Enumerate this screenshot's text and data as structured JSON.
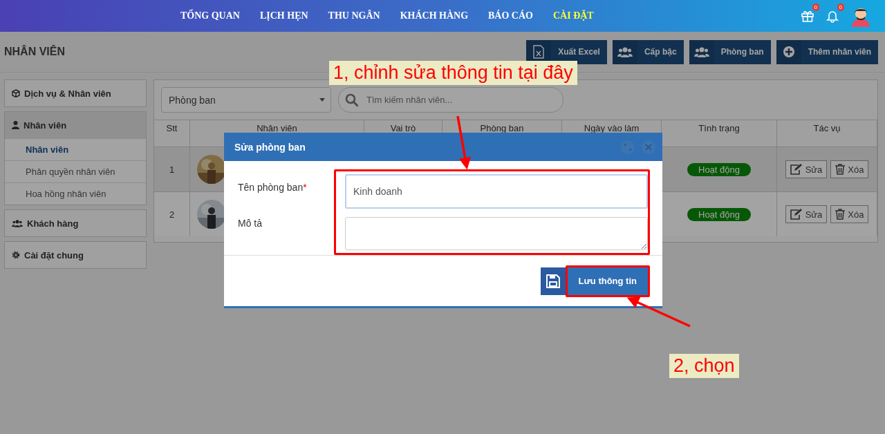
{
  "nav": {
    "items": [
      {
        "label": "TỔNG QUAN",
        "selected": false
      },
      {
        "label": "LỊCH HẸN",
        "selected": false
      },
      {
        "label": "THU NGÂN",
        "selected": false
      },
      {
        "label": "KHÁCH HÀNG",
        "selected": false
      },
      {
        "label": "BÁO CÁO",
        "selected": false
      },
      {
        "label": "CÀI ĐẶT",
        "selected": true
      }
    ],
    "gift_badge": "0",
    "bell_badge": "0"
  },
  "page_title": "NHÂN VIÊN",
  "actions": [
    {
      "label": "Xuất Excel",
      "kind": "excel"
    },
    {
      "label": "Cấp bậc",
      "kind": "group"
    },
    {
      "label": "Phòng ban",
      "kind": "group"
    },
    {
      "label": "Thêm nhân viên",
      "kind": "plus"
    }
  ],
  "sidebar": [
    {
      "label": "Dịch vụ & Nhân viên",
      "kind": "box"
    },
    {
      "label": "Nhân viên",
      "kind": "user",
      "expanded": true,
      "children": [
        {
          "label": "Nhân viên",
          "selected": true
        },
        {
          "label": "Phân quyền nhân viên",
          "selected": false
        },
        {
          "label": "Hoa hồng nhân viên",
          "selected": false
        }
      ]
    },
    {
      "label": "Khách hàng",
      "kind": "group"
    },
    {
      "label": "Cài đặt chung",
      "kind": "gear"
    }
  ],
  "filter": {
    "department": "Phòng ban",
    "search_placeholder": "Tìm kiếm nhân viên..."
  },
  "table": {
    "columns": [
      "Stt",
      "Nhân viên",
      "Vai trò",
      "Phòng ban",
      "Ngày vào làm",
      "Tình trạng",
      "Tác vụ"
    ],
    "rows": [
      {
        "stt": "1",
        "status": "Hoạt động",
        "edit": "Sửa",
        "delete": "Xóa",
        "selected": true
      },
      {
        "stt": "2",
        "status": "Hoạt động",
        "edit": "Sửa",
        "delete": "Xóa",
        "selected": false
      }
    ]
  },
  "modal": {
    "title": "Sửa phòng ban",
    "fields": [
      {
        "label": "Tên phòng ban",
        "required_mark": "*",
        "value": "Kinh doanh",
        "kind": "input"
      },
      {
        "label": "Mô tả",
        "kind": "textarea"
      }
    ],
    "save_button": "Lưu thông tin"
  },
  "annotations": [
    {
      "text": "1, chỉnh sửa thông tin tại đây"
    },
    {
      "text": "2, chọn"
    }
  ]
}
